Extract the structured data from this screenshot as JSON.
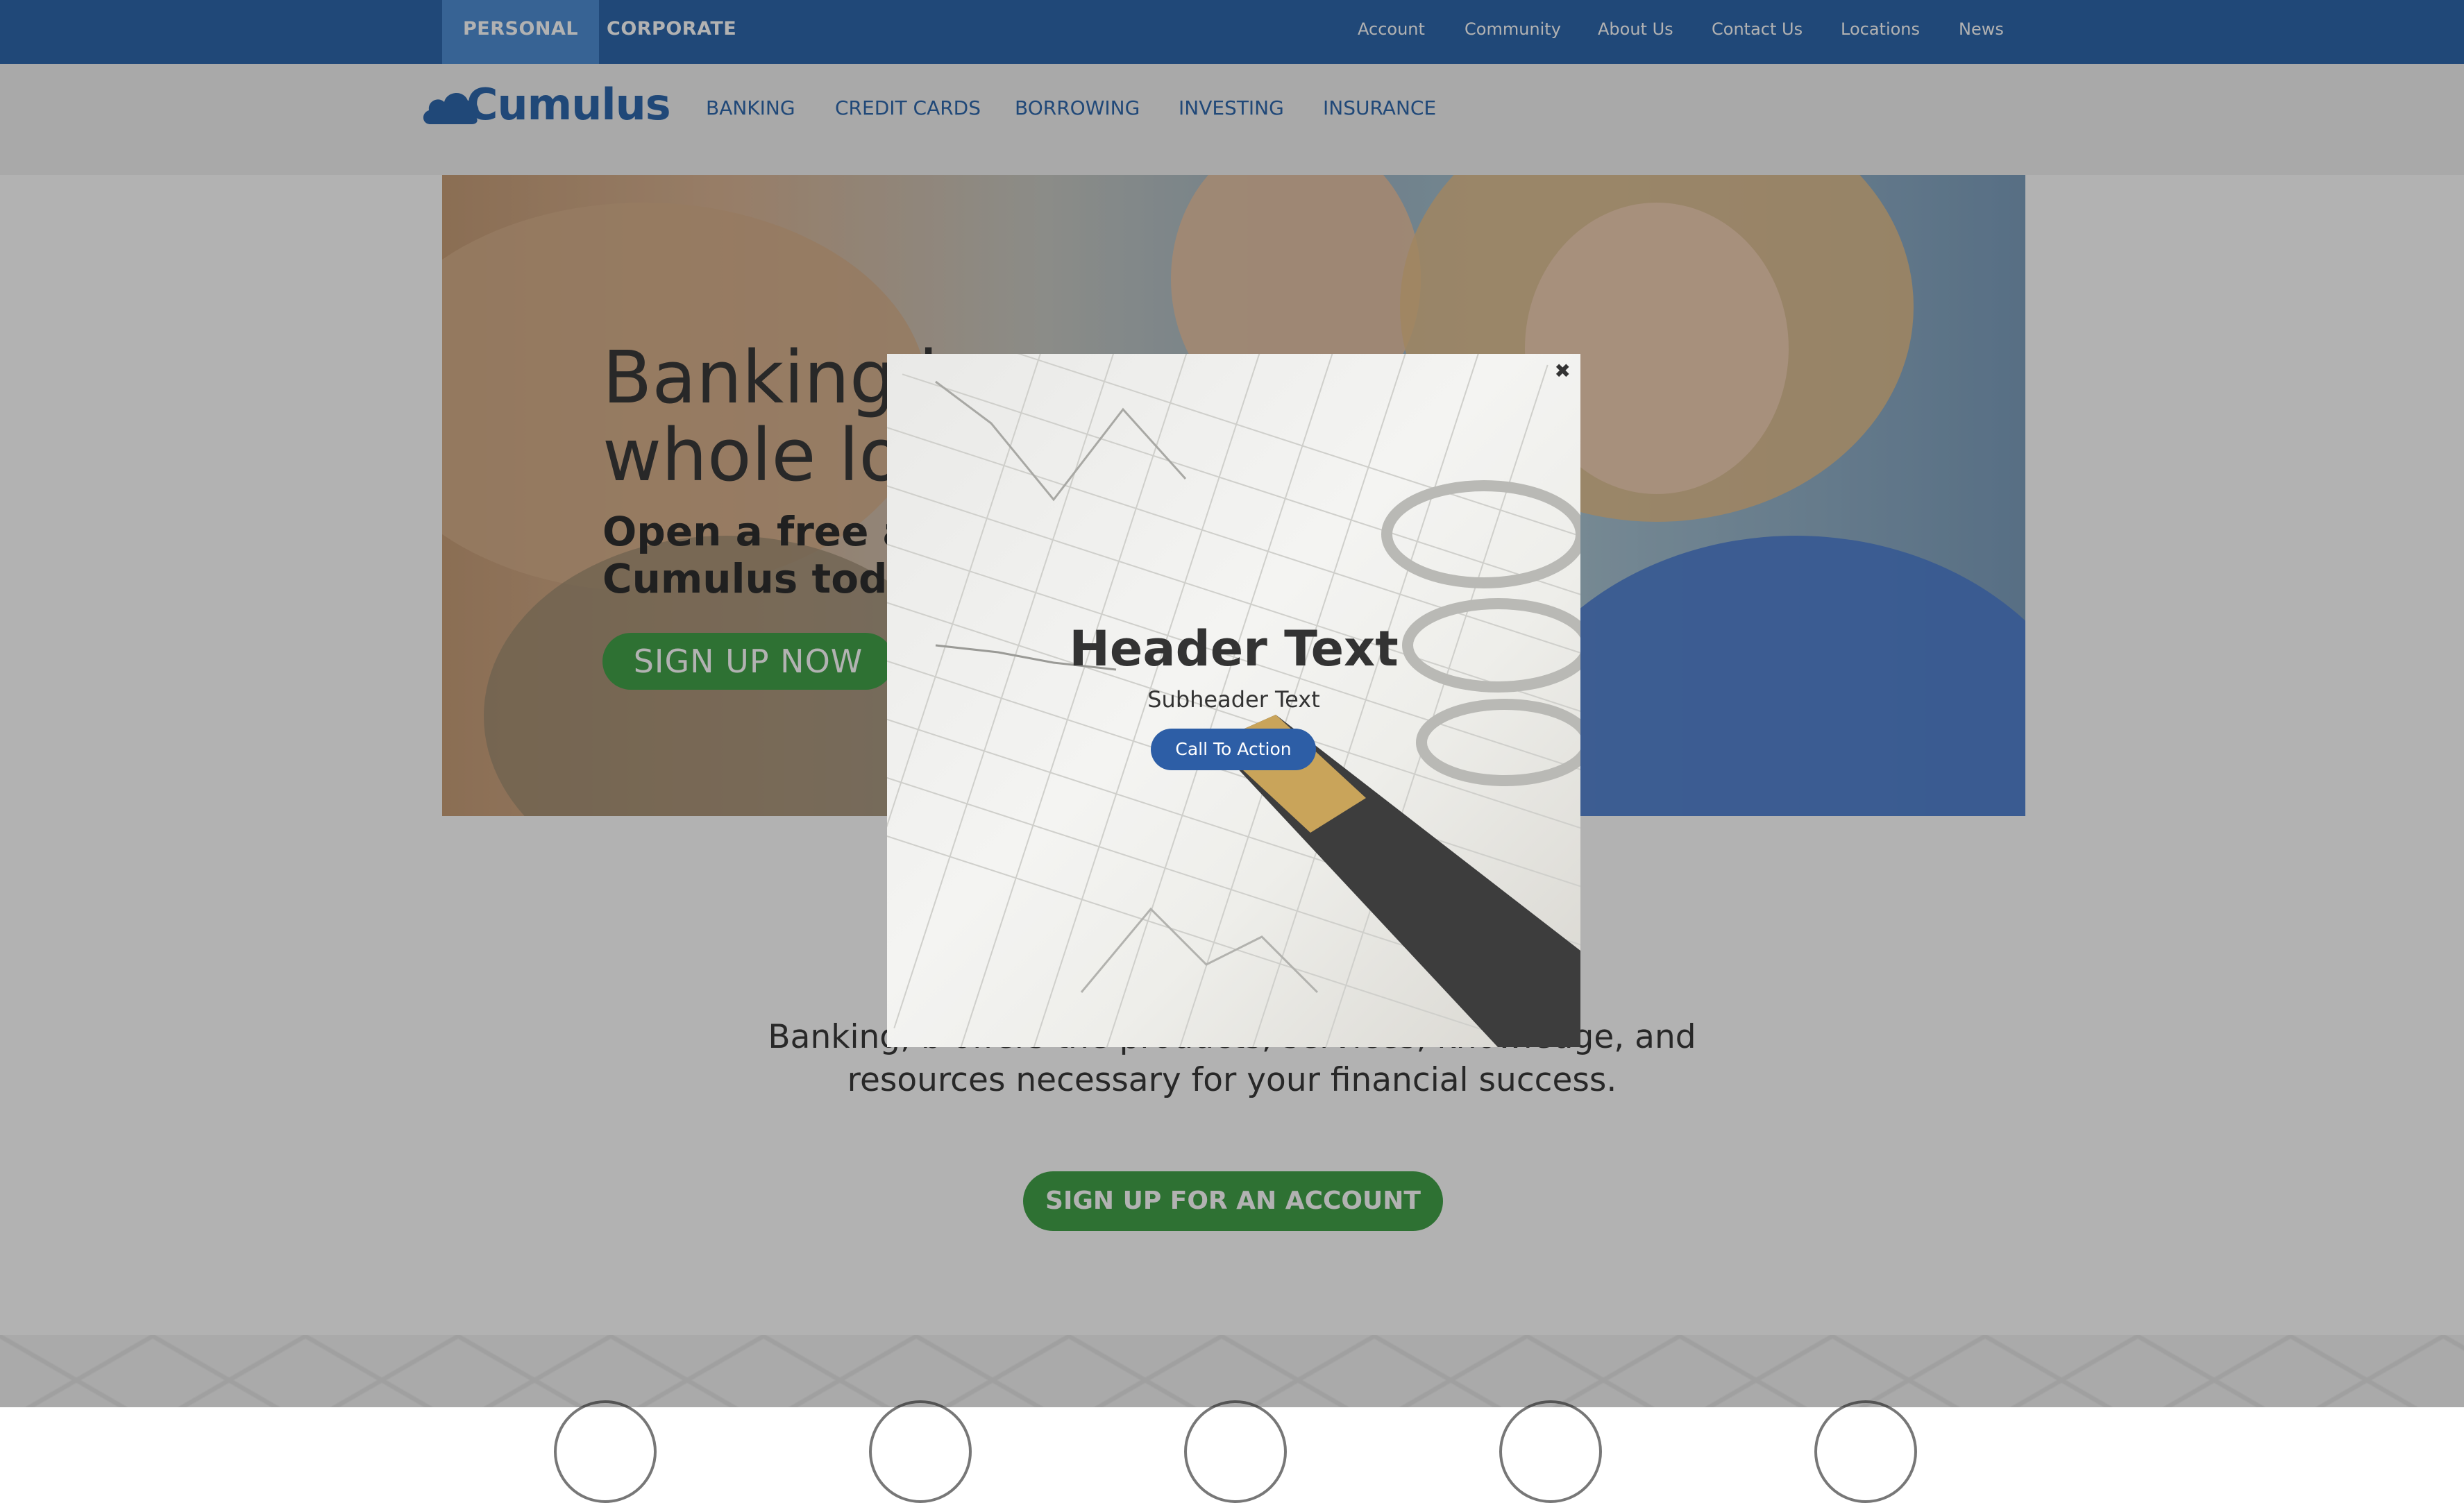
{
  "utility_bar": {
    "segments": [
      {
        "label": "PERSONAL",
        "active": true
      },
      {
        "label": "CORPORATE",
        "active": false
      }
    ],
    "links": [
      "Account",
      "Community",
      "About Us",
      "Contact Us",
      "Locations",
      "News"
    ]
  },
  "brand": {
    "name": "Cumulus",
    "logo_icon": "cloud-icon"
  },
  "main_nav": [
    "BANKING",
    "CREDIT CARDS",
    "BORROWING",
    "INVESTING",
    "INSURANCE"
  ],
  "hero": {
    "title_visible": "Banking j\nwhole lot",
    "subtitle_visible": "Open a free acc\nCumulus today!",
    "button": "SIGN UP NOW"
  },
  "about": {
    "text": "Banking, b                                                       offers the products, services, knowledge, and resources necessary for your financial success.",
    "button": "SIGN UP FOR AN ACCOUNT"
  },
  "modal": {
    "close_icon": "close-icon",
    "header": "Header Text",
    "subheader": "Subheader Text",
    "cta": "Call To Action"
  },
  "colors": {
    "brand_blue": "#2e68ad",
    "active_tab": "#4f8fd5",
    "cta_green": "#43a24a",
    "modal_button": "#2d5ea6"
  }
}
